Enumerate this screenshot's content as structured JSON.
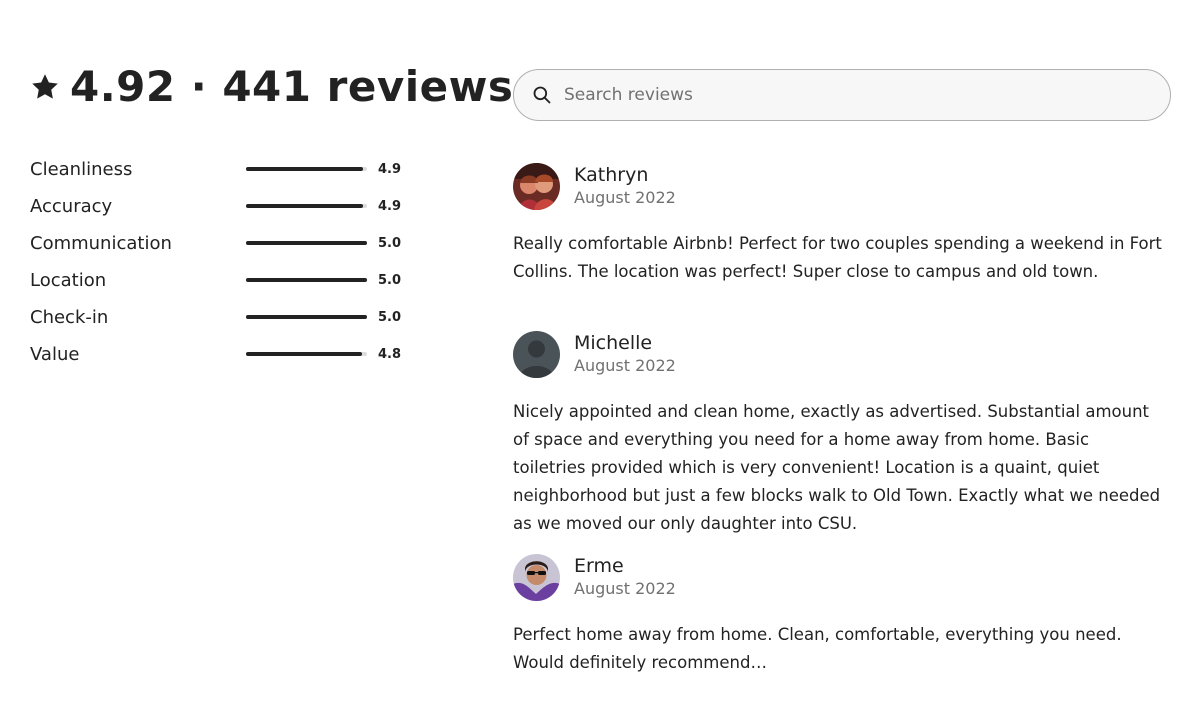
{
  "summary": {
    "text": "4.92 · 441 reviews",
    "icon": "star-icon"
  },
  "ratings": [
    {
      "label": "Cleanliness",
      "value": "4.9",
      "fill": 0.97
    },
    {
      "label": "Accuracy",
      "value": "4.9",
      "fill": 0.97
    },
    {
      "label": "Communication",
      "value": "5.0",
      "fill": 1.0
    },
    {
      "label": "Location",
      "value": "5.0",
      "fill": 1.0
    },
    {
      "label": "Check-in",
      "value": "5.0",
      "fill": 1.0
    },
    {
      "label": "Value",
      "value": "4.8",
      "fill": 0.96
    }
  ],
  "search": {
    "placeholder": "Search reviews",
    "value": "",
    "icon": "search-icon"
  },
  "reviews": [
    {
      "name": "Kathryn",
      "date": "August 2022",
      "text": "Really comfortable Airbnb! Perfect for two couples spending a weekend in Fort Collins. The location was perfect! Super close to campus and old town."
    },
    {
      "name": "Michelle",
      "date": "August 2022",
      "text": "Nicely appointed and clean home, exactly as advertised. Substantial amount of space and everything you need for a home away from home. Basic toiletries provided which is very convenient! Location is a quaint, quiet neighborhood but just a few blocks walk to Old Town. Exactly what we needed as we moved our only daughter into CSU."
    },
    {
      "name": "Erme",
      "date": "August 2022",
      "text": "Perfect home away from home. Clean, comfortable, everything you need. Would definitely recommend…"
    }
  ],
  "colors": {
    "text": "#222222",
    "muted": "#717171",
    "bar_track": "#dddddd",
    "bar_fill": "#222222"
  }
}
